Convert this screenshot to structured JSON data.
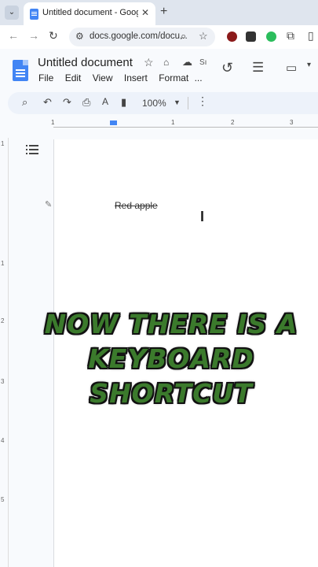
{
  "browser": {
    "tab": {
      "title": "Untitled document - Google Docs"
    },
    "address": {
      "url": "docs.google.com/docu..."
    }
  },
  "docs": {
    "title": "Untitled document",
    "menu": [
      "File",
      "Edit",
      "View",
      "Insert",
      "Format",
      "..."
    ],
    "star_truncated": "Sı",
    "toolbar": {
      "zoom": "100%"
    },
    "ruler_numbers": [
      "1",
      "1",
      "2",
      "3"
    ],
    "vertical_ruler_numbers": [
      "1",
      "1",
      "2",
      "3",
      "4",
      "5"
    ]
  },
  "document": {
    "text": "Red apple"
  },
  "overlay": {
    "lines": [
      "Now there is a",
      "keyboard",
      "shortcut"
    ]
  },
  "colors": {
    "docs_blue": "#4285f4",
    "caption_green": "#3b7a2c",
    "page_bg": "#ffffff",
    "canvas_bg": "#f8fafd"
  }
}
